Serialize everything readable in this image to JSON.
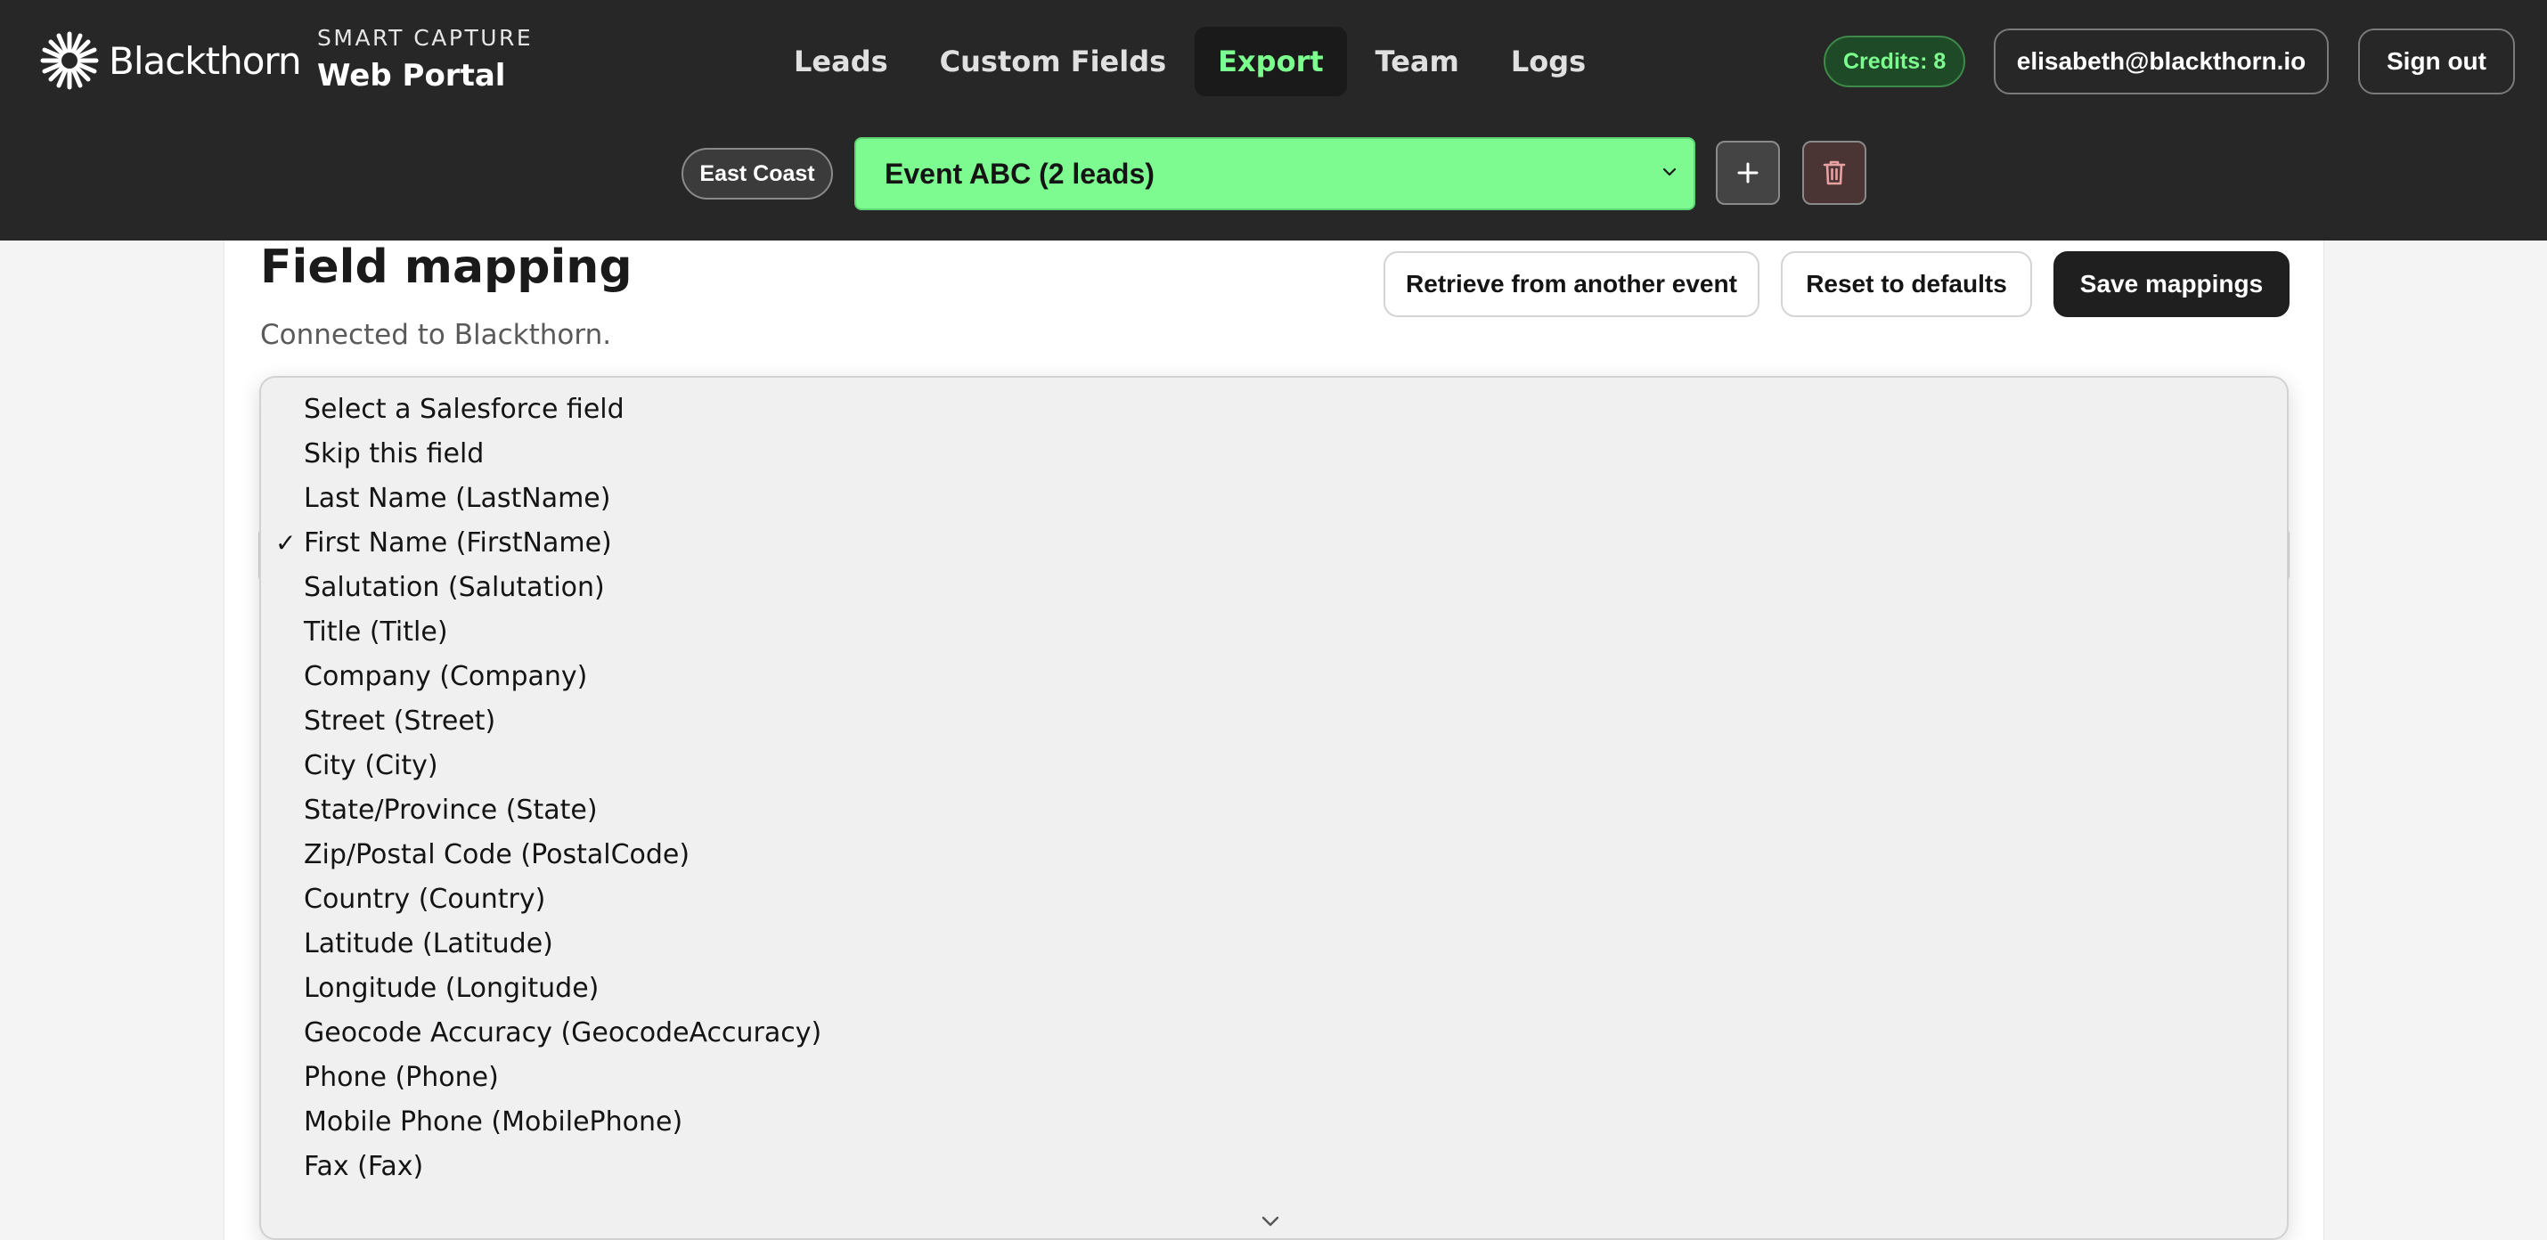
{
  "header": {
    "brand": "Blackthorn",
    "portal_kicker": "SMART CAPTURE",
    "portal_title": "Web Portal",
    "nav": [
      {
        "label": "Leads"
      },
      {
        "label": "Custom Fields"
      },
      {
        "label": "Export",
        "active": true
      },
      {
        "label": "Team"
      },
      {
        "label": "Logs"
      }
    ],
    "credits": "Credits: 8",
    "user_email": "elisabeth@blackthorn.io",
    "sign_out": "Sign out"
  },
  "event_bar": {
    "region": "East Coast",
    "event_selected": "Event ABC (2 leads)",
    "add_icon": "plus-icon",
    "delete_icon": "trash-icon"
  },
  "panel": {
    "title": "Field mapping",
    "subtitle": "Connected to Blackthorn.",
    "retrieve_label": "Retrieve from another event",
    "reset_label": "Reset to defaults",
    "save_label": "Save mappings"
  },
  "dropdown": {
    "options": [
      "Select a Salesforce field",
      "Skip this field",
      "Last Name (LastName)",
      "First Name (FirstName)",
      "Salutation (Salutation)",
      "Title (Title)",
      "Company (Company)",
      "Street (Street)",
      "City (City)",
      "State/Province (State)",
      "Zip/Postal Code (PostalCode)",
      "Country (Country)",
      "Latitude (Latitude)",
      "Longitude (Longitude)",
      "Geocode Accuracy (GeocodeAccuracy)",
      "Phone (Phone)",
      "Mobile Phone (MobilePhone)",
      "Fax (Fax)"
    ],
    "selected_index": 3,
    "check_glyph": "✓"
  },
  "colors": {
    "header_bg": "#272727",
    "accent_green": "#7dfa90",
    "active_nav": "#7dff90"
  }
}
